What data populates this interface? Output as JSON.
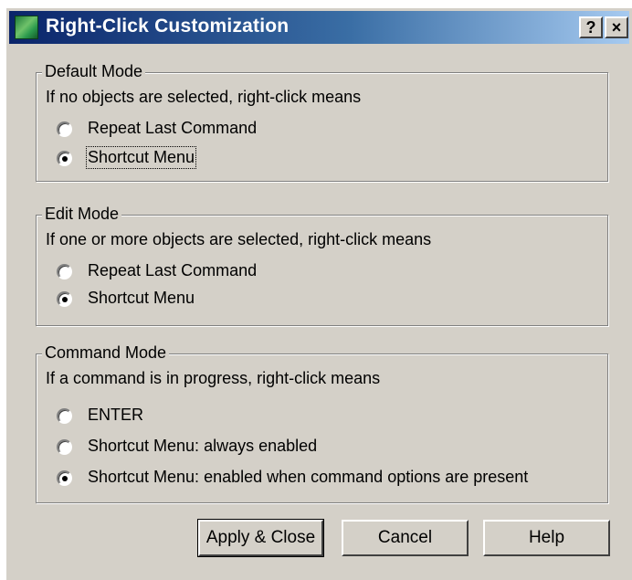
{
  "window": {
    "title": "Right-Click Customization",
    "help_glyph": "?",
    "close_glyph": "×"
  },
  "default_mode": {
    "legend": "Default Mode",
    "description": "If no objects are selected, right-click means",
    "options": [
      {
        "label": "Repeat Last Command",
        "checked": false
      },
      {
        "label": "Shortcut Menu",
        "checked": true
      }
    ]
  },
  "edit_mode": {
    "legend": "Edit Mode",
    "description": "If one or more objects are selected, right-click means",
    "options": [
      {
        "label": "Repeat Last Command",
        "checked": false
      },
      {
        "label": "Shortcut Menu",
        "checked": true
      }
    ]
  },
  "command_mode": {
    "legend": "Command Mode",
    "description": "If a command is in progress, right-click means",
    "options": [
      {
        "label": "ENTER",
        "checked": false
      },
      {
        "label": "Shortcut Menu: always enabled",
        "checked": false
      },
      {
        "label": "Shortcut Menu: enabled when command options are present",
        "checked": true
      }
    ]
  },
  "buttons": {
    "apply": "Apply & Close",
    "cancel": "Cancel",
    "help": "Help"
  },
  "colors": {
    "face": "#d4d0c8",
    "title_start": "#0a246a",
    "title_end": "#a6caf0"
  }
}
